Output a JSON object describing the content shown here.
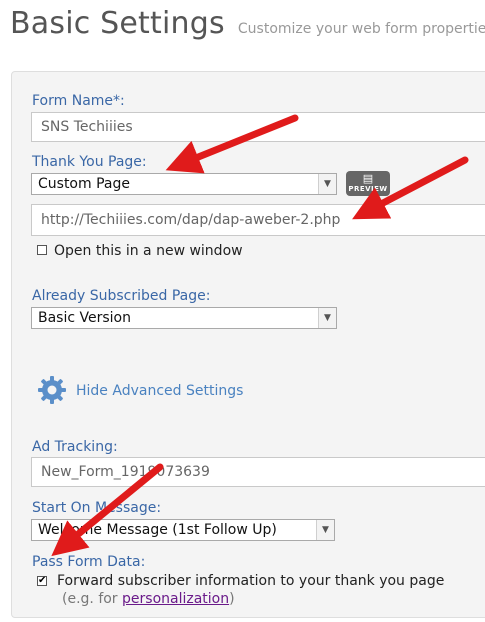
{
  "header": {
    "title": "Basic Settings",
    "subtitle": "Customize your web form properties."
  },
  "form": {
    "form_name": {
      "label": "Form Name*:",
      "value": "SNS Techiiies"
    },
    "thank_you": {
      "label": "Thank You Page:",
      "selected": "Custom Page",
      "preview_label": "PREVIEW",
      "url": "http://Techiiies.com/dap/dap-aweber-2.php",
      "new_window_label": "Open this in a new window",
      "new_window_checked": false
    },
    "already_subscribed": {
      "label": "Already Subscribed Page:",
      "selected": "Basic Version"
    },
    "advanced_link": "Hide Advanced Settings",
    "ad_tracking": {
      "label": "Ad Tracking:",
      "value": "New_Form_1919073639"
    },
    "start_on_message": {
      "label": "Start On Message:",
      "selected": "Welcome Message (1st Follow Up)"
    },
    "pass_form_data": {
      "label": "Pass Form Data:",
      "checkbox_label": "Forward subscriber information to your thank you page",
      "checked": true,
      "hint_prefix": "(e.g. for ",
      "hint_link": "personalization",
      "hint_suffix": ")"
    }
  },
  "icons": {
    "dropdown": "chevron-down-icon",
    "preview": "document-icon",
    "advanced": "gear-icon",
    "annotation": "red-arrow"
  },
  "colors": {
    "label": "#3a67a6",
    "link": "#4a82c0",
    "visited_link": "#6a1a8a",
    "annotation_arrow": "#e01b1b",
    "panel_bg": "#f4f4f4",
    "preview_button": "#666666"
  }
}
